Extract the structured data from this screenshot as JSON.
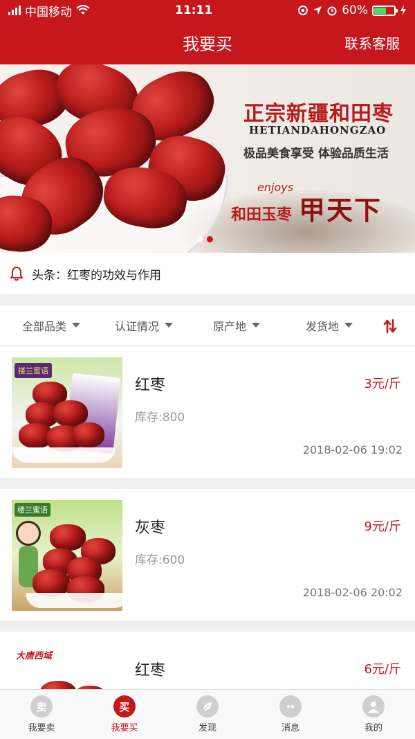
{
  "status_bar": {
    "carrier": "中国移动",
    "time": "11:11",
    "battery": "60%",
    "battery_level": 0.6
  },
  "header": {
    "title": "我要买",
    "service_label": "联系客服"
  },
  "banner": {
    "title": "正宗新疆和田枣",
    "subtitle": "HETIANDAHONGZAO",
    "slogan": "极品美食享受  体验品质生活",
    "enjoy_text": "enjoys",
    "line_left": "和田玉枣",
    "line_right": "甲天下",
    "slide_count": 2,
    "active_slide": 2
  },
  "headline": {
    "text": "头条：红枣的功效与作用"
  },
  "filters": {
    "category": "全部品类",
    "certification": "认证情况",
    "origin": "原产地",
    "ship_from": "发货地"
  },
  "products": [
    {
      "name": "红枣",
      "price": "3元/斤",
      "stock": "库存:800",
      "time": "2018-02-06 19:02",
      "brand": "楼兰蜜语"
    },
    {
      "name": "灰枣",
      "price": "9元/斤",
      "stock": "库存:600",
      "time": "2018-02-06 20:02",
      "brand": "楼兰蜜语"
    },
    {
      "name": "红枣",
      "price": "6元/斤",
      "stock": "",
      "time": "",
      "brand": "大唐西域"
    }
  ],
  "tabbar": {
    "tabs": [
      {
        "label": "我要卖",
        "glyph": "卖",
        "icon": "sell-icon",
        "active": false
      },
      {
        "label": "我要买",
        "glyph": "买",
        "icon": "buy-icon",
        "active": true
      },
      {
        "label": "发现",
        "glyph": "",
        "icon": "leaf-icon",
        "active": false
      },
      {
        "label": "消息",
        "glyph": "",
        "icon": "chat-icon",
        "active": false
      },
      {
        "label": "我的",
        "glyph": "",
        "icon": "user-icon",
        "active": false
      }
    ]
  },
  "colors": {
    "brand_red": "#c6171c",
    "price_red": "#c6171c"
  }
}
